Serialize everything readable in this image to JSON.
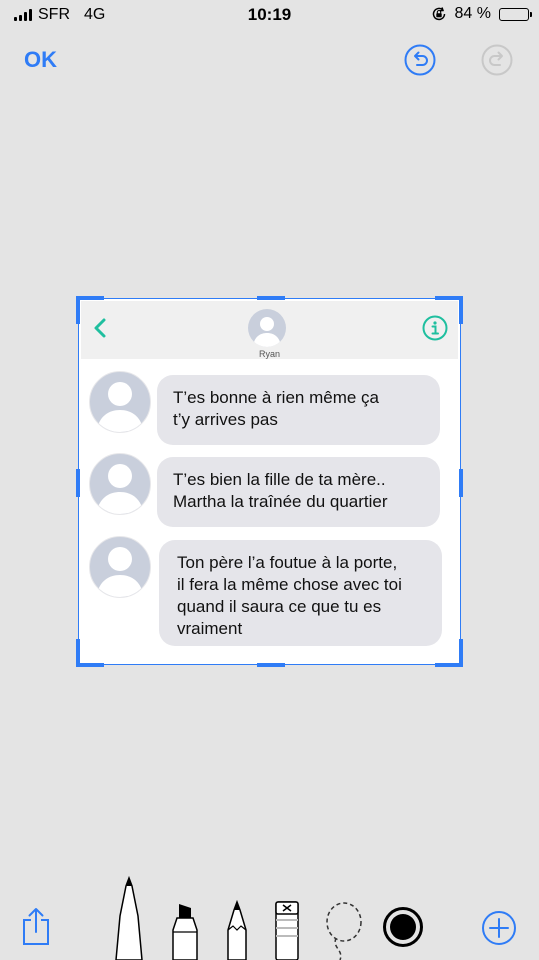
{
  "status_bar": {
    "carrier": "SFR",
    "network": "4G",
    "time": "10:19",
    "battery_percent": "84 %",
    "battery_level": 0.84,
    "icons": [
      "signal-icon",
      "rotation-lock-icon",
      "battery-icon"
    ]
  },
  "toolbar": {
    "ok_label": "OK",
    "undo_icon": "undo-icon",
    "redo_icon": "redo-icon"
  },
  "screenshot": {
    "contact_name": "Ryan",
    "messages": [
      {
        "lines": [
          "T’es bonne à rien même ça",
          "t’y arrives pas"
        ]
      },
      {
        "lines": [
          "T’es bien la fille de ta mère..",
          "Martha la traînée du quartier"
        ]
      },
      {
        "lines": [
          "Ton père l’a foutue à la porte,",
          "il fera la même chose avec toi",
          "quand il saura ce que tu es",
          "vraiment"
        ]
      }
    ]
  },
  "tools": {
    "items": [
      "share-icon",
      "pen-icon",
      "marker-icon",
      "pencil-icon",
      "eraser-icon",
      "lasso-icon",
      "color-picker-icon",
      "add-icon"
    ],
    "selected_color": "#000000",
    "accent": "#2f7cf6"
  }
}
